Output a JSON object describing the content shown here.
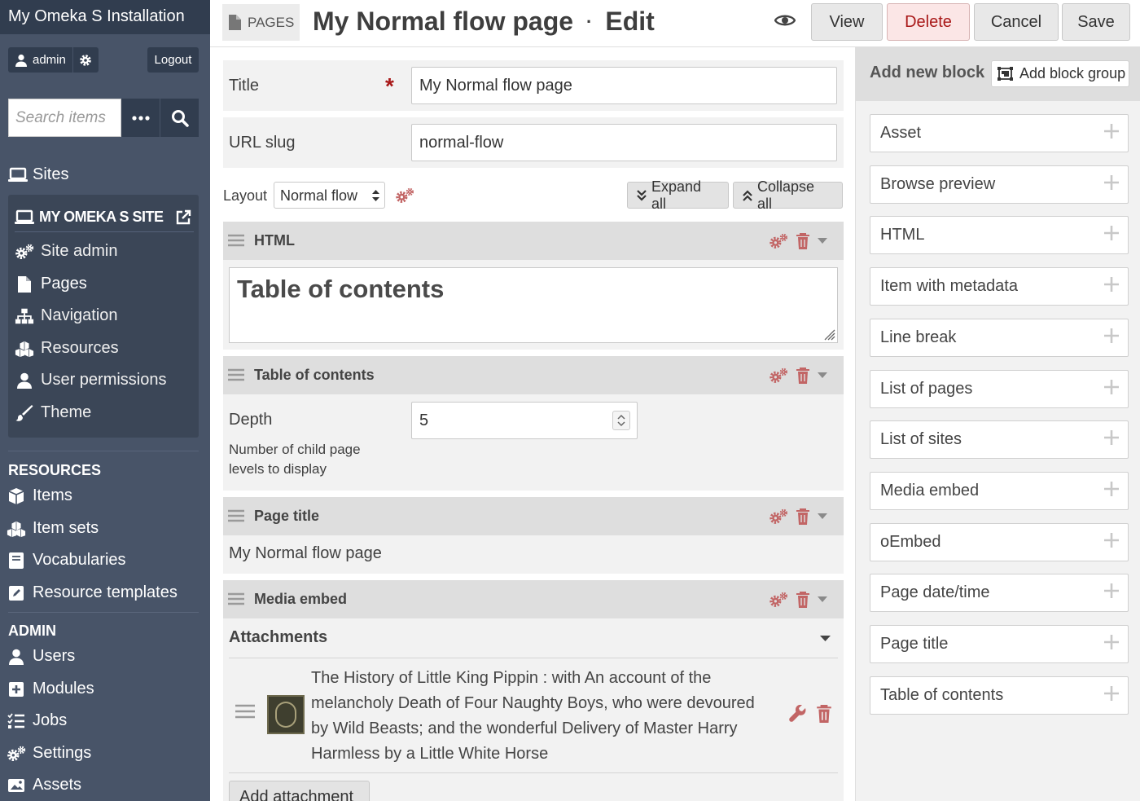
{
  "app": {
    "installation_title": "My Omeka S Installation"
  },
  "user": {
    "name": "admin",
    "logout_label": "Logout"
  },
  "search": {
    "placeholder": "Search items"
  },
  "sidebar": {
    "sites_label": "Sites",
    "site_name": "MY OMEKA S SITE",
    "site_nav": [
      {
        "label": "Site admin",
        "icon": "gears-icon"
      },
      {
        "label": "Pages",
        "icon": "file-icon"
      },
      {
        "label": "Navigation",
        "icon": "sitemap-icon"
      },
      {
        "label": "Resources",
        "icon": "cubes-icon"
      },
      {
        "label": "User permissions",
        "icon": "user-icon"
      },
      {
        "label": "Theme",
        "icon": "paintbrush-icon"
      }
    ],
    "resources_heading": "RESOURCES",
    "resources": [
      {
        "label": "Items",
        "icon": "cube-icon"
      },
      {
        "label": "Item sets",
        "icon": "cubes-icon"
      },
      {
        "label": "Vocabularies",
        "icon": "book-icon"
      },
      {
        "label": "Resource templates",
        "icon": "edit-icon"
      }
    ],
    "admin_heading": "ADMIN",
    "admin": [
      {
        "label": "Users",
        "icon": "user-icon"
      },
      {
        "label": "Modules",
        "icon": "plus-square-icon"
      },
      {
        "label": "Jobs",
        "icon": "tasks-icon"
      },
      {
        "label": "Settings",
        "icon": "gears-icon"
      },
      {
        "label": "Assets",
        "icon": "image-icon"
      }
    ]
  },
  "header": {
    "section_label": "PAGES",
    "page_title": "My Normal flow page",
    "separator": "·",
    "mode": "Edit",
    "buttons": {
      "view": "View",
      "delete": "Delete",
      "cancel": "Cancel",
      "save": "Save"
    }
  },
  "form": {
    "title_label": "Title",
    "required_mark": "*",
    "title_value": "My Normal flow page",
    "slug_label": "URL slug",
    "slug_value": "normal-flow",
    "layout_label": "Layout",
    "layout_value": "Normal flow",
    "expand_all": "Expand all",
    "collapse_all": "Collapse all"
  },
  "blocks": [
    {
      "name": "HTML",
      "content": "Table of contents"
    },
    {
      "name": "Table of contents",
      "depth_label": "Depth",
      "depth_value": "5",
      "depth_help": "Number of child page levels to display"
    },
    {
      "name": "Page title",
      "content": "My Normal flow page"
    },
    {
      "name": "Media embed",
      "attachments_label": "Attachments",
      "attachment_title": "The History of Little King Pippin : with An account of the melancholy Death of Four Naughty Boys, who were devoured by Wild Beasts; and the wonderful Delivery of Master Harry Harmless by a Little White Horse",
      "add_attachment": "Add attachment"
    }
  ],
  "right_panel": {
    "title": "Add new block",
    "add_group": "Add block group",
    "block_types": [
      "Asset",
      "Browse preview",
      "HTML",
      "Item with metadata",
      "Line break",
      "List of pages",
      "List of sites",
      "Media embed",
      "oEmbed",
      "Page date/time",
      "Page title",
      "Table of contents"
    ]
  },
  "colors": {
    "sidebar": "#485468",
    "sidebar_dark": "#313d4f",
    "accent_red": "#a91919",
    "action_icon": "#c26565"
  }
}
